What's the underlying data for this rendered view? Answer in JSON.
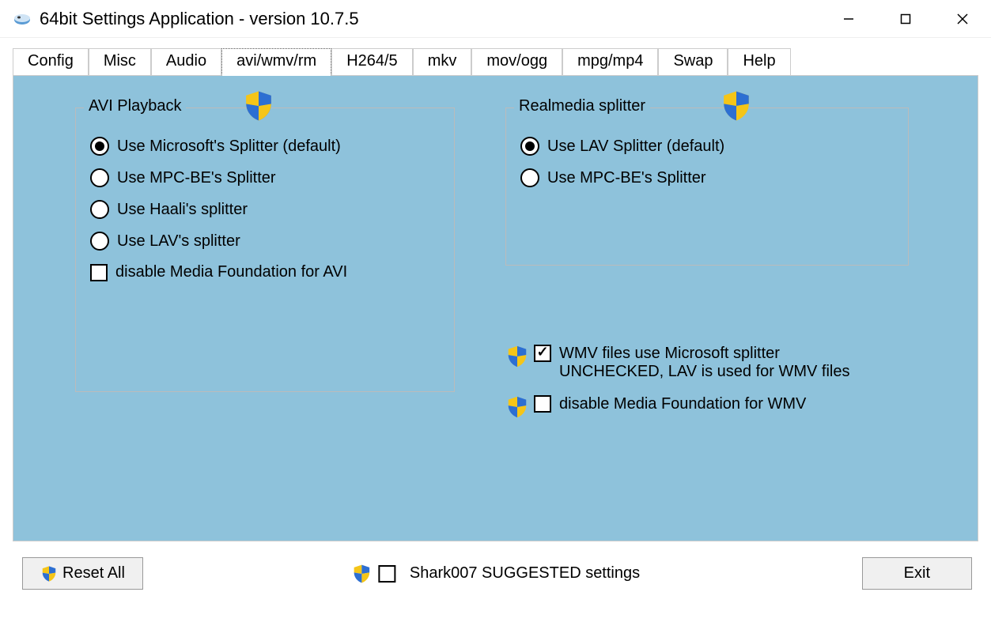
{
  "window": {
    "title": "64bit Settings Application - version 10.7.5"
  },
  "tabs": [
    {
      "label": "Config"
    },
    {
      "label": "Misc"
    },
    {
      "label": "Audio"
    },
    {
      "label": "avi/wmv/rm"
    },
    {
      "label": "H264/5"
    },
    {
      "label": "mkv"
    },
    {
      "label": "mov/ogg"
    },
    {
      "label": "mpg/mp4"
    },
    {
      "label": "Swap"
    },
    {
      "label": "Help"
    }
  ],
  "avi_playback": {
    "legend": "AVI Playback",
    "options": [
      {
        "label": "Use Microsoft's Splitter (default)",
        "selected": true
      },
      {
        "label": "Use MPC-BE's Splitter",
        "selected": false
      },
      {
        "label": "Use Haali's splitter",
        "selected": false
      },
      {
        "label": "Use LAV's splitter",
        "selected": false
      }
    ],
    "disable_mf_label": "disable Media Foundation for AVI",
    "disable_mf_checked": false
  },
  "realmedia": {
    "legend": "Realmedia splitter",
    "options": [
      {
        "label": "Use LAV Splitter (default)",
        "selected": true
      },
      {
        "label": "Use MPC-BE's Splitter",
        "selected": false
      }
    ]
  },
  "wmv": {
    "ms_splitter_label": "WMV files use Microsoft splitter",
    "ms_splitter_sub": "UNCHECKED, LAV is used for WMV files",
    "ms_splitter_checked": true,
    "disable_mf_label": "disable Media Foundation for WMV",
    "disable_mf_checked": false
  },
  "footer": {
    "reset_label": "Reset All",
    "suggested_label": "Shark007 SUGGESTED settings",
    "suggested_checked": false,
    "exit_label": "Exit"
  }
}
